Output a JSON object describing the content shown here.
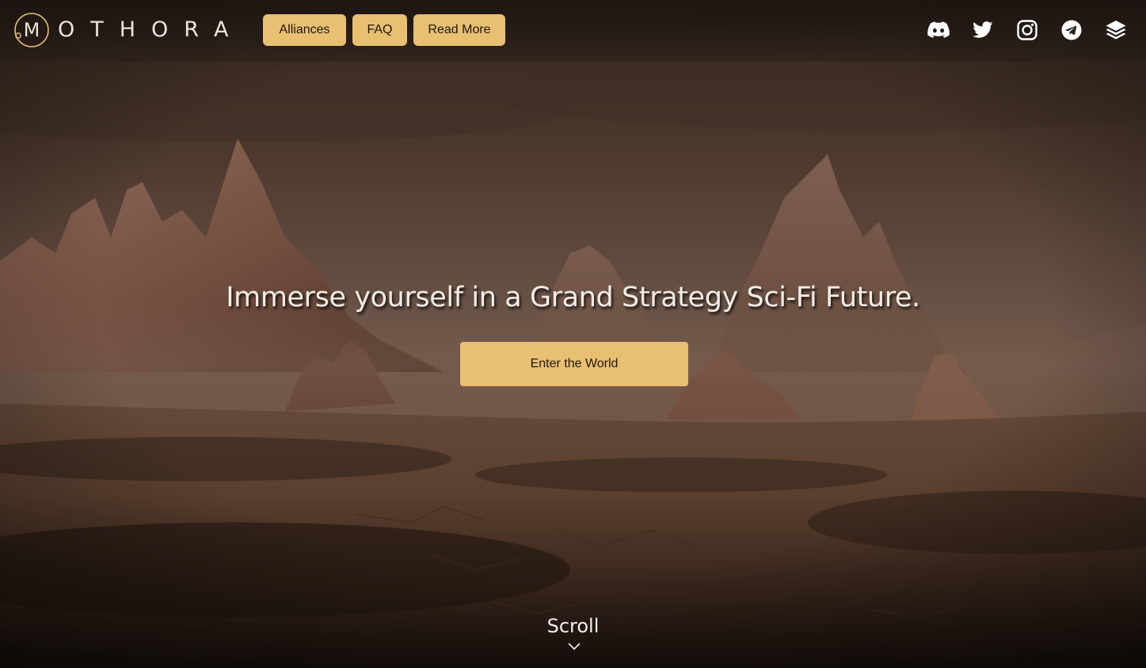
{
  "brand": {
    "name": "OTHORA",
    "initial": "M",
    "accent_color": "#e9bf72"
  },
  "nav": {
    "alliances_label": "Alliances",
    "faq_label": "FAQ",
    "read_more_label": "Read More"
  },
  "social": {
    "icons": [
      "discord-icon",
      "twitter-icon",
      "instagram-icon",
      "telegram-icon",
      "layers-icon"
    ]
  },
  "hero": {
    "headline": "Immerse yourself in a Grand Strategy Sci-Fi Future.",
    "cta_label": "Enter the World",
    "background_description": "desert landscape with rock spires"
  },
  "scroll": {
    "label": "Scroll"
  }
}
